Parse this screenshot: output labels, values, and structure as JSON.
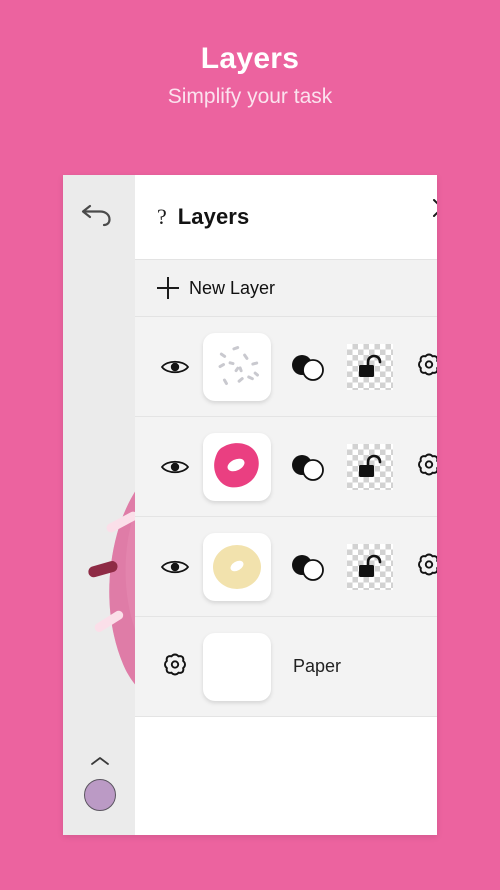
{
  "promo": {
    "title": "Layers",
    "subtitle": "Simplify your task",
    "background_color": "#ec639f",
    "title_color": "#ffffff",
    "subtitle_color": "#fbe2ee"
  },
  "toolbar": {
    "undo_icon": "undo-arrow-icon",
    "expand_icon": "chevron-up-icon",
    "color_swatch": {
      "name": "color-swatch",
      "color": "#bb9ac5",
      "border_color": "#5b5560"
    },
    "canvas_preview": {
      "name": "canvas-donut-preview",
      "icing_color": "#e384ad",
      "icing_shadow": "#d9739f",
      "sprinkle_light": "#f9d3e0",
      "sprinkle_dark": "#8e2b45"
    }
  },
  "panel": {
    "title": "Layers",
    "help_icon": "question-mark-icon",
    "close_icon": "close-x-icon",
    "background": "#ffffff",
    "new_layer": {
      "label": "New Layer",
      "icon": "plus-icon"
    },
    "columns": [
      "visibility",
      "thumbnail",
      "blend-mode",
      "lock",
      "settings"
    ],
    "layers": [
      {
        "index": 0,
        "name": "sprinkles-layer",
        "visible": true,
        "visibility_icon": "eye-icon",
        "blend_icon": "blend-mode-circles-icon",
        "lock_icon": "unlock-icon",
        "locked": false,
        "settings_icon": "gear-icon",
        "thumbnail": {
          "type": "sprinkles",
          "background": "#ffffff",
          "mark_color": "#c9c9cf"
        }
      },
      {
        "index": 1,
        "name": "icing-layer",
        "visible": true,
        "visibility_icon": "eye-icon",
        "blend_icon": "blend-mode-circles-icon",
        "lock_icon": "unlock-icon",
        "locked": false,
        "settings_icon": "gear-icon",
        "thumbnail": {
          "type": "donut-icing",
          "background": "#ffffff",
          "fill_color": "#ea3f81",
          "hole_color": "#ffffff"
        }
      },
      {
        "index": 2,
        "name": "dough-layer",
        "visible": true,
        "visibility_icon": "eye-icon",
        "blend_icon": "blend-mode-circles-icon",
        "lock_icon": "unlock-icon",
        "locked": false,
        "settings_icon": "gear-icon",
        "thumbnail": {
          "type": "donut-dough",
          "background": "#ffffff",
          "fill_color": "#f2e2ad",
          "hole_color": "#ffffff"
        }
      }
    ],
    "paper": {
      "label": "Paper",
      "settings_icon": "gear-icon",
      "thumbnail": {
        "type": "blank",
        "background": "#ffffff"
      }
    }
  }
}
